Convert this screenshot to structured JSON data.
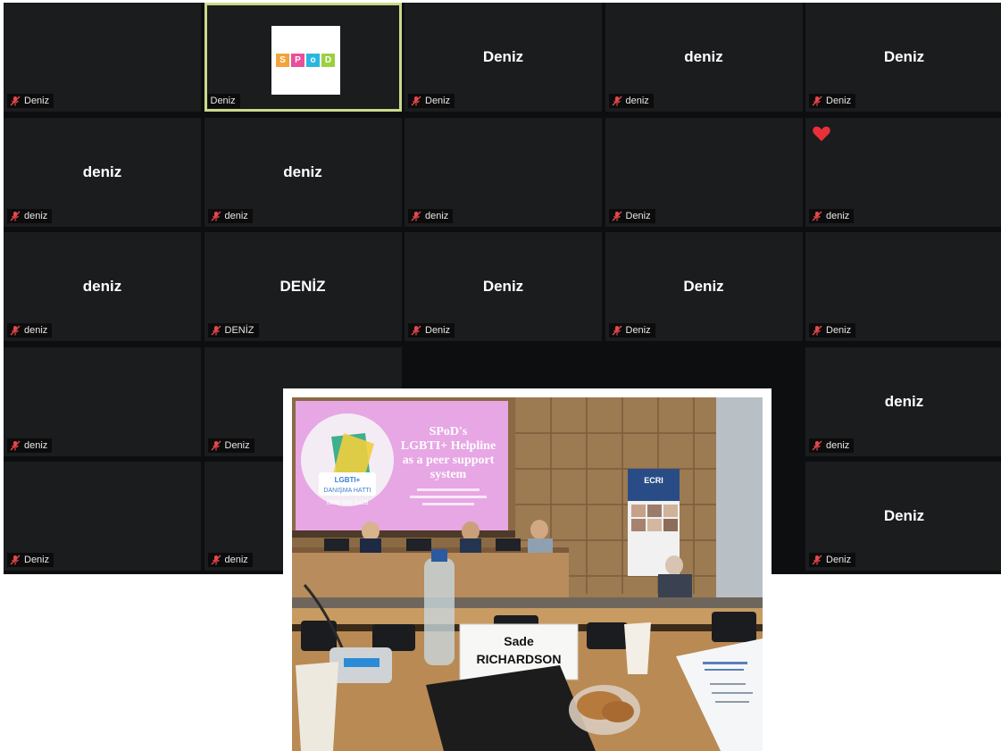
{
  "tiles": [
    {
      "name": "Deniz",
      "display": "",
      "muted": true
    },
    {
      "name": "Deniz",
      "display": "",
      "muted": false,
      "logo": [
        "S",
        "P",
        "o",
        "D"
      ],
      "active": true
    },
    {
      "name": "Deniz",
      "display": "Deniz",
      "muted": true
    },
    {
      "name": "deniz",
      "display": "deniz",
      "muted": true
    },
    {
      "name": "Deniz",
      "display": "Deniz",
      "muted": true
    },
    {
      "name": "deniz",
      "display": "deniz",
      "muted": true
    },
    {
      "name": "deniz",
      "display": "deniz",
      "muted": true
    },
    {
      "name": "deniz",
      "display": "",
      "muted": true
    },
    {
      "name": "Deniz",
      "display": "",
      "muted": true
    },
    {
      "name": "deniz",
      "display": "",
      "muted": true,
      "reaction": "heart"
    },
    {
      "name": "deniz",
      "display": "deniz",
      "muted": true
    },
    {
      "name": "DENİZ",
      "display": "DENİZ",
      "muted": true
    },
    {
      "name": "Deniz",
      "display": "Deniz",
      "muted": true
    },
    {
      "name": "Deniz",
      "display": "Deniz",
      "muted": true
    },
    {
      "name": "Deniz",
      "display": "",
      "muted": true
    },
    {
      "name": "deniz",
      "display": "",
      "muted": true
    },
    {
      "name": "Deniz",
      "display": "",
      "muted": true
    },
    {
      "name": "",
      "display": "",
      "muted": false,
      "hidden": true
    },
    {
      "name": "",
      "display": "",
      "muted": false,
      "hidden": true
    },
    {
      "name": "deniz",
      "display": "deniz",
      "muted": true
    },
    {
      "name": "Deniz",
      "display": "",
      "muted": true
    },
    {
      "name": "deniz",
      "display": "",
      "muted": true
    },
    {
      "name": "",
      "display": "",
      "muted": false,
      "hidden": true
    },
    {
      "name": "",
      "display": "",
      "muted": false,
      "hidden": true
    },
    {
      "name": "Deniz",
      "display": "Deniz",
      "muted": true
    }
  ],
  "colors": {
    "logo": [
      "#f2a33a",
      "#e94f9b",
      "#29b6e0",
      "#9bd13f"
    ],
    "active_border": "#c9d98a",
    "mic_muted": "#e8474a"
  },
  "photo": {
    "slide_title": "SPoD's LGBTI+ Helpline as a peer support system",
    "slide_title_lines": [
      "SPoD's",
      "LGBTI+ Helpline",
      "as a peer support",
      "system"
    ],
    "slide_badge": [
      "LGBTI+",
      "DANIŞMA HATTI"
    ],
    "slide_phone": "0850 888 5428",
    "banner_title": "ECRI",
    "name_card_first": "Sade",
    "name_card_last": "RICHARDSON"
  }
}
